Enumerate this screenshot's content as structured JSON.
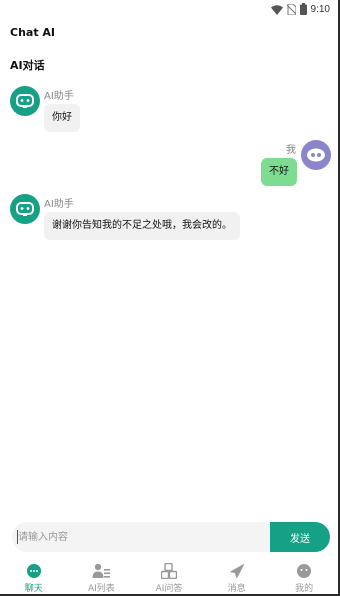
{
  "status_bar": {
    "time": "9:10"
  },
  "app_title": "Chat AI",
  "section_title": "AI对话",
  "messages": [
    {
      "sender": "AI助手",
      "text": "你好",
      "role": "ai"
    },
    {
      "sender": "我",
      "text": "不好",
      "role": "me"
    },
    {
      "sender": "AI助手",
      "text": "谢谢你告知我的不足之处哦，我会改的。",
      "role": "ai"
    }
  ],
  "input": {
    "placeholder": "请输入内容",
    "value": ""
  },
  "send_label": "发送",
  "tabs": [
    {
      "label": "聊天",
      "icon": "chat-bubble-icon",
      "active": true
    },
    {
      "label": "AI列表",
      "icon": "user-list-icon",
      "active": false
    },
    {
      "label": "AI问答",
      "icon": "qa-blocks-icon",
      "active": false
    },
    {
      "label": "消息",
      "icon": "paper-plane-icon",
      "active": false
    },
    {
      "label": "我的",
      "icon": "profile-bubble-icon",
      "active": false
    }
  ],
  "colors": {
    "accent": "#16a085",
    "me_bubble": "#7ddc92",
    "ai_bubble": "#f1f1f1",
    "me_avatar": "#8b86c9"
  }
}
